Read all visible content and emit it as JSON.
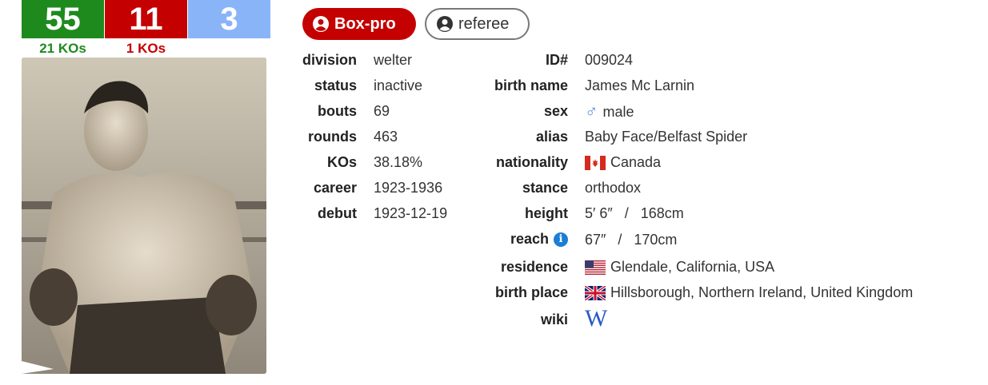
{
  "record": {
    "wins": "55",
    "losses": "11",
    "draws": "3",
    "wins_kos": "21 KOs",
    "losses_kos": "1 KOs",
    "colors": {
      "wins": "#1e8a1e",
      "losses": "#c40000",
      "draws": "#8ab4f8"
    }
  },
  "buttons": {
    "boxpro": "Box-pro",
    "referee": "referee"
  },
  "left": [
    {
      "label": "division",
      "value": "welter"
    },
    {
      "label": "status",
      "value": "inactive"
    },
    {
      "label": "bouts",
      "value": "69"
    },
    {
      "label": "rounds",
      "value": "463"
    },
    {
      "label": "KOs",
      "value": "38.18%"
    },
    {
      "label": "career",
      "value": "1923-1936"
    },
    {
      "label": "debut",
      "value": "1923-12-19"
    }
  ],
  "right": {
    "id": {
      "label": "ID#",
      "value": "009024"
    },
    "birth_name": {
      "label": "birth name",
      "value": "James Mc Larnin"
    },
    "sex": {
      "label": "sex",
      "value": "male",
      "icon": "male-symbol-icon"
    },
    "alias": {
      "label": "alias",
      "value": "Baby Face/Belfast Spider"
    },
    "nationality": {
      "label": "nationality",
      "value": "Canada",
      "icon": "canada-flag-icon"
    },
    "stance": {
      "label": "stance",
      "value": "orthodox"
    },
    "height": {
      "label": "height",
      "value": "5′ 6″   /   168cm"
    },
    "reach": {
      "label": "reach",
      "value": "67″   /   170cm",
      "icon": "info-icon"
    },
    "residence": {
      "label": "residence",
      "value": "Glendale, California, USA",
      "icon": "usa-flag-icon"
    },
    "birth_place": {
      "label": "birth place",
      "value": "Hillsborough, Northern Ireland, United Kingdom",
      "icon": "uk-flag-icon"
    },
    "wiki": {
      "label": "wiki",
      "icon": "wikipedia-icon",
      "glyph": "W"
    }
  }
}
